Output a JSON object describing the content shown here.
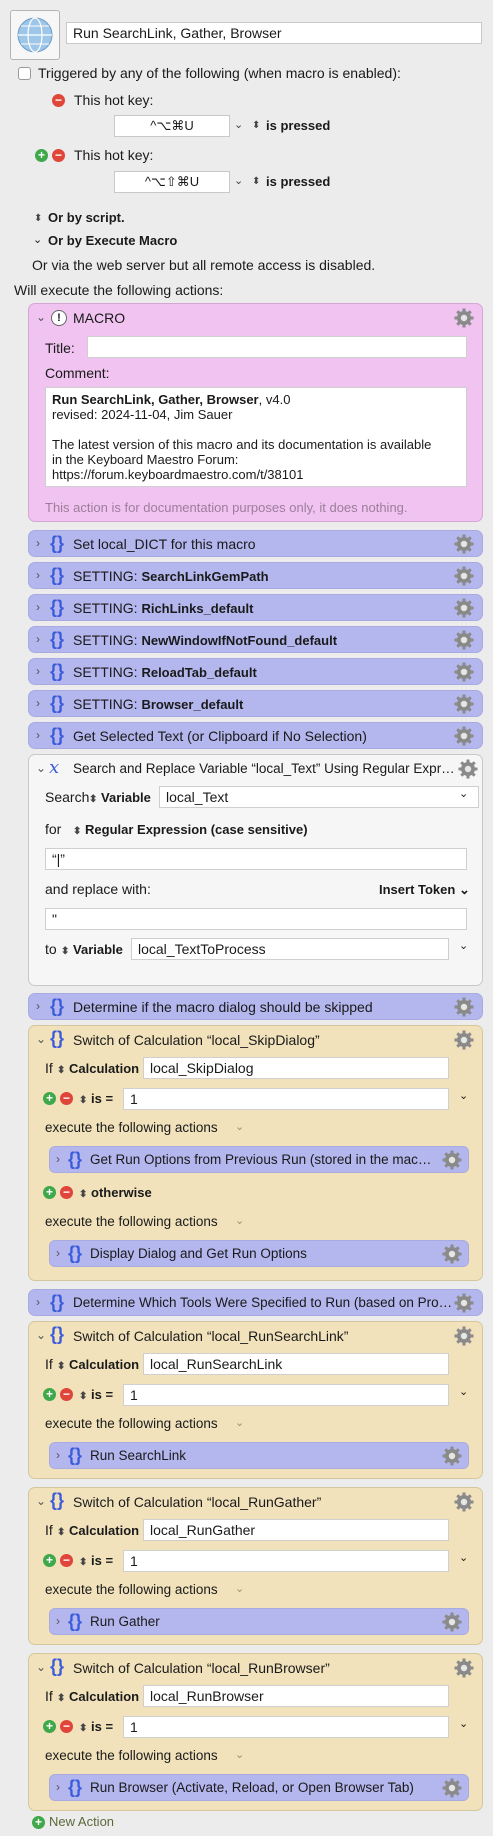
{
  "macro": {
    "name": "Run SearchLink, Gather, Browser",
    "trigger_label": "Triggered by any of the following (when macro is enabled):",
    "hotkeys": [
      {
        "label": "This hot key:",
        "keys": "^⌥⌘U",
        "condition": "is pressed"
      },
      {
        "label": "This hot key:",
        "keys": "^⌥⇧⌘U",
        "condition": "is pressed"
      }
    ],
    "or_by_script": "Or by script.",
    "or_by_execute": "Or by Execute Macro",
    "web_server_note": "Or via the web server but all remote access is disabled.",
    "will_execute": "Will execute the following actions:"
  },
  "comment_action": {
    "header": "MACRO",
    "title_label": "Title:",
    "comment_label": "Comment:",
    "comment_title_bold": "Run SearchLink, Gather, Browser",
    "comment_title_suffix": ", v4.0",
    "comment_revised": "revised: 2024-11-04, Jim Sauer",
    "comment_line1": "The latest version of this macro and its documentation is available",
    "comment_line2": "in the Keyboard Maestro Forum:",
    "comment_line3": "https://forum.keyboardmaestro.com/t/38101",
    "footer": "This action is for documentation purposes only, it does nothing."
  },
  "groups": [
    {
      "prefix": "",
      "label": "Set local_DICT for this macro"
    },
    {
      "prefix": "SETTING: ",
      "label": "SearchLinkGemPath"
    },
    {
      "prefix": "SETTING: ",
      "label": "RichLinks_default"
    },
    {
      "prefix": "SETTING: ",
      "label": "NewWindowIfNotFound_default"
    },
    {
      "prefix": "SETTING: ",
      "label": "ReloadTab_default"
    },
    {
      "prefix": "SETTING: ",
      "label": "Browser_default"
    },
    {
      "prefix": "",
      "label": "Get Selected Text (or Clipboard if No Selection)"
    }
  ],
  "search_replace": {
    "header": "Search and Replace Variable “local_Text” Using Regular Expr…",
    "search_label": "Search",
    "variable_label": "Variable",
    "search_var": "local_Text",
    "for_label": "for",
    "regex_label": "Regular Expression (case sensitive)",
    "pattern": "“|”",
    "replace_label": "and replace with:",
    "insert_token": "Insert Token",
    "replacement": "\"",
    "to_label": "to",
    "to_var": "local_TextToProcess"
  },
  "determine_skip": "Determine if the macro dialog should be skipped",
  "switch_skip": {
    "header": "Switch of Calculation “local_SkipDialog”",
    "if_label": "If",
    "calc_label": "Calculation",
    "calc_value": "local_SkipDialog",
    "is_label": "is =",
    "is_value": "1",
    "execute_label": "execute the following actions",
    "case1_action": "Get Run Options from Previous Run (stored in the mac…",
    "otherwise_label": "otherwise",
    "case2_action": "Display Dialog and Get Run Options"
  },
  "determine_tools": "Determine Which Tools Were Specified to Run (based on Pro…",
  "switches": [
    {
      "header": "Switch of Calculation “local_RunSearchLink”",
      "calc_value": "local_RunSearchLink",
      "is_value": "1",
      "action": "Run SearchLink"
    },
    {
      "header": "Switch of Calculation “local_RunGather”",
      "calc_value": "local_RunGather",
      "is_value": "1",
      "action": "Run Gather"
    },
    {
      "header": "Switch of Calculation “local_RunBrowser”",
      "calc_value": "local_RunBrowser",
      "is_value": "1",
      "action": "Run Browser (Activate, Reload, or Open Browser Tab)"
    }
  ],
  "switch_common": {
    "if_label": "If",
    "calc_label": "Calculation",
    "is_label": "is =",
    "execute_label": "execute the following actions"
  },
  "new_action": "New Action"
}
